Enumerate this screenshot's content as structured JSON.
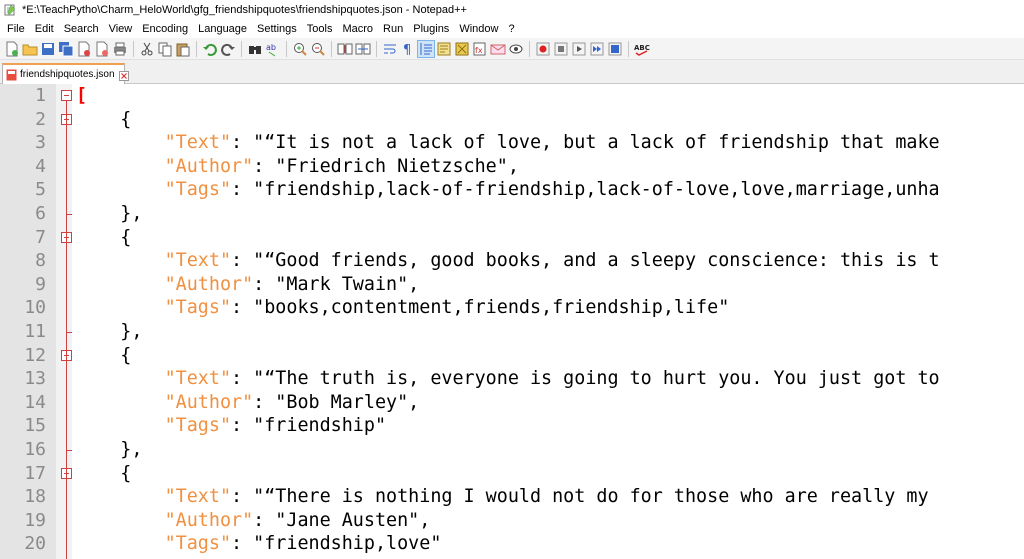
{
  "window": {
    "title": "*E:\\TeachPytho\\Charm_HeloWorld\\gfg_friendshipquotes\\friendshipquotes.json - Notepad++"
  },
  "menu": [
    {
      "label": "File",
      "name": "menu-file"
    },
    {
      "label": "Edit",
      "name": "menu-edit"
    },
    {
      "label": "Search",
      "name": "menu-search"
    },
    {
      "label": "View",
      "name": "menu-view"
    },
    {
      "label": "Encoding",
      "name": "menu-encoding"
    },
    {
      "label": "Language",
      "name": "menu-language"
    },
    {
      "label": "Settings",
      "name": "menu-settings"
    },
    {
      "label": "Tools",
      "name": "menu-tools"
    },
    {
      "label": "Macro",
      "name": "menu-macro"
    },
    {
      "label": "Run",
      "name": "menu-run"
    },
    {
      "label": "Plugins",
      "name": "menu-plugins"
    },
    {
      "label": "Window",
      "name": "menu-window"
    },
    {
      "label": "?",
      "name": "menu-help"
    }
  ],
  "tab": {
    "label": "friendshipquotes.json"
  },
  "colors": {
    "key": "#f09040",
    "bracket": "#ff0000",
    "fold": "#d04040",
    "tab_accent": "#f0a050"
  },
  "editor": {
    "lines": [
      {
        "n": "1",
        "parts": [
          [
            "b",
            "["
          ]
        ]
      },
      {
        "n": "2",
        "parts": [
          [
            "t",
            "    {"
          ]
        ]
      },
      {
        "n": "3",
        "parts": [
          [
            "t",
            "        "
          ],
          [
            "k",
            "\"Text\""
          ],
          [
            "t",
            ": \"“It is not a lack of love, but a lack of friendship that make"
          ]
        ]
      },
      {
        "n": "4",
        "parts": [
          [
            "t",
            "        "
          ],
          [
            "k",
            "\"Author\""
          ],
          [
            "t",
            ": \"Friedrich Nietzsche\","
          ]
        ]
      },
      {
        "n": "5",
        "parts": [
          [
            "t",
            "        "
          ],
          [
            "k",
            "\"Tags\""
          ],
          [
            "t",
            ": \"friendship,lack-of-friendship,lack-of-love,love,marriage,unha"
          ]
        ]
      },
      {
        "n": "6",
        "parts": [
          [
            "t",
            "    },"
          ]
        ]
      },
      {
        "n": "7",
        "parts": [
          [
            "t",
            "    {"
          ]
        ]
      },
      {
        "n": "8",
        "parts": [
          [
            "t",
            "        "
          ],
          [
            "k",
            "\"Text\""
          ],
          [
            "t",
            ": \"“Good friends, good books, and a sleepy conscience: this is t"
          ]
        ]
      },
      {
        "n": "9",
        "parts": [
          [
            "t",
            "        "
          ],
          [
            "k",
            "\"Author\""
          ],
          [
            "t",
            ": \"Mark Twain\","
          ]
        ]
      },
      {
        "n": "10",
        "parts": [
          [
            "t",
            "        "
          ],
          [
            "k",
            "\"Tags\""
          ],
          [
            "t",
            ": \"books,contentment,friends,friendship,life\""
          ]
        ]
      },
      {
        "n": "11",
        "parts": [
          [
            "t",
            "    },"
          ]
        ]
      },
      {
        "n": "12",
        "parts": [
          [
            "t",
            "    {"
          ]
        ]
      },
      {
        "n": "13",
        "parts": [
          [
            "t",
            "        "
          ],
          [
            "k",
            "\"Text\""
          ],
          [
            "t",
            ": \"“The truth is, everyone is going to hurt you. You just got to"
          ]
        ]
      },
      {
        "n": "14",
        "parts": [
          [
            "t",
            "        "
          ],
          [
            "k",
            "\"Author\""
          ],
          [
            "t",
            ": \"Bob Marley\","
          ]
        ]
      },
      {
        "n": "15",
        "parts": [
          [
            "t",
            "        "
          ],
          [
            "k",
            "\"Tags\""
          ],
          [
            "t",
            ": \"friendship\""
          ]
        ]
      },
      {
        "n": "16",
        "parts": [
          [
            "t",
            "    },"
          ]
        ]
      },
      {
        "n": "17",
        "parts": [
          [
            "t",
            "    {"
          ]
        ]
      },
      {
        "n": "18",
        "parts": [
          [
            "t",
            "        "
          ],
          [
            "k",
            "\"Text\""
          ],
          [
            "t",
            ": \"“There is nothing I would not do for those who are really my"
          ]
        ]
      },
      {
        "n": "19",
        "parts": [
          [
            "t",
            "        "
          ],
          [
            "k",
            "\"Author\""
          ],
          [
            "t",
            ": \"Jane Austen\","
          ]
        ]
      },
      {
        "n": "20",
        "parts": [
          [
            "t",
            "        "
          ],
          [
            "k",
            "\"Tags\""
          ],
          [
            "t",
            ": \"friendship,love\""
          ]
        ]
      }
    ],
    "fold_open_lines": [
      1,
      2,
      7,
      12,
      17
    ]
  }
}
